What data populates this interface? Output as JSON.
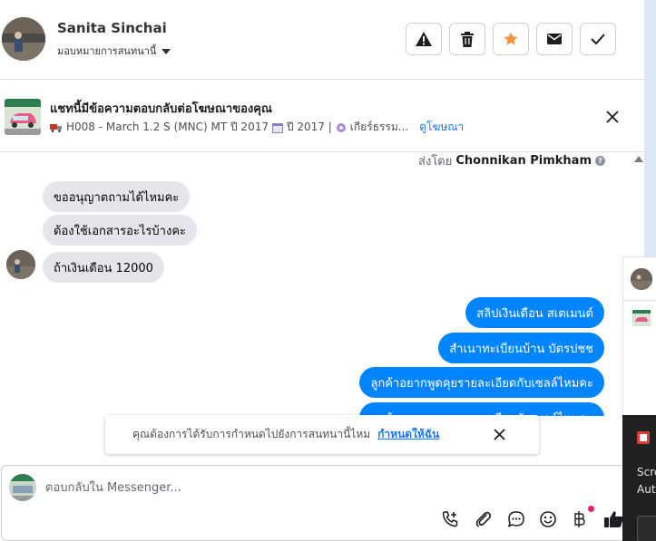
{
  "header": {
    "contact_name": "Sanita Sinchai",
    "assign_label": "มอบหมายการสนทนานี้",
    "actions": [
      {
        "name": "spam-icon",
        "label": "report"
      },
      {
        "name": "trash-icon",
        "label": "delete"
      },
      {
        "name": "star-icon",
        "label": "follow up"
      },
      {
        "name": "envelope-icon",
        "label": "mark unread"
      },
      {
        "name": "check-icon",
        "label": "done"
      }
    ],
    "star_color": "#f7923b"
  },
  "ad": {
    "title": "แชทนี้มีข้อความตอบกลับต่อโฆษณาของคุณ",
    "vehicle": "H008 - March 1.2 S (MNC) MT ปี 2017",
    "year": "ปี 2017 |",
    "gear": "เกียร์ธรรม...",
    "link": "ดูโฆษณา"
  },
  "conversation": {
    "sent_by_prefix": "ส่งโดย",
    "sent_by_name": "Chonnikan Pimkham",
    "help": "?",
    "incoming": [
      "ขออนุญาตถามได้ไหมคะ",
      "ต้องใช้เอกสารอะไรบ้างคะ",
      "ถ้าเงินเดือน 12000"
    ],
    "outgoing": [
      "สลิปเงินเดือน สเตเมนต์",
      "สำเนาทะเบียนบ้าน บัตรปชช",
      "ลูกค้าอยากพูดคุยรายละเอียดกับเซลล์ไหมคะ",
      "ลูกค้าอยากพูดคุยรายละเอียดกับเซลล์ไหมคะ"
    ],
    "bubble_in_color": "#e4e6eb",
    "bubble_out_color": "#0084ff"
  },
  "toast": {
    "text": "คุณต้องการได้รับการกำหนดไปยังการสนทนานี้ไหม",
    "link": "กำหนดให้ฉัน"
  },
  "composer": {
    "placeholder": "ตอบกลับใน Messenger...",
    "tools": [
      "call-add-icon",
      "attachment-icon",
      "saved-reply-icon",
      "emoji-icon",
      "baht-icon",
      "like-icon"
    ]
  },
  "side_panel": {
    "dark_line1": "Scre",
    "dark_line2": "Aut"
  }
}
